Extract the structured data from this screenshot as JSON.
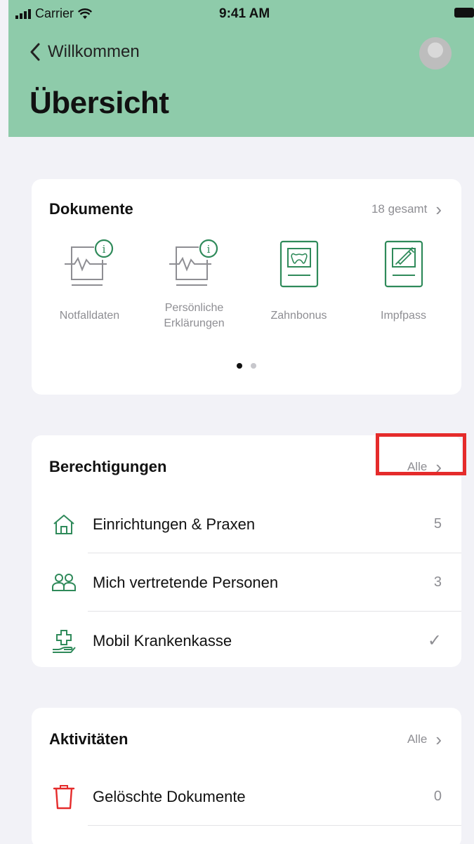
{
  "status_bar": {
    "carrier": "Carrier",
    "time": "9:41 AM"
  },
  "nav": {
    "back_label": "Willkommen",
    "title": "Übersicht"
  },
  "documents": {
    "title": "Dokumente",
    "total_label": "18 gesamt",
    "items": [
      {
        "label": "Notfalldaten",
        "icon": "health-info-icon"
      },
      {
        "label": "Persönliche Erklärungen",
        "icon": "health-info-icon"
      },
      {
        "label": "Zahnbonus",
        "icon": "tooth-document-icon"
      },
      {
        "label": "Impfpass",
        "icon": "syringe-document-icon"
      }
    ],
    "page_index": 1,
    "page_count": 2
  },
  "permissions": {
    "title": "Berechtigungen",
    "all_label": "Alle",
    "rows": [
      {
        "label": "Einrichtungen & Praxen",
        "value": "5",
        "icon": "house-icon"
      },
      {
        "label": "Mich vertretende Personen",
        "value": "3",
        "icon": "people-icon"
      },
      {
        "label": "Mobil Krankenkasse",
        "value": "✓",
        "icon": "insurance-hand-icon"
      }
    ]
  },
  "activities": {
    "title": "Aktivitäten",
    "all_label": "Alle",
    "rows": [
      {
        "label": "Gelöschte Dokumente",
        "value": "0",
        "icon": "trash-icon"
      }
    ]
  },
  "colors": {
    "header_bg": "#8ecbaa",
    "icon_green": "#2f8a5a",
    "accent_red": "#e52b2b",
    "secondary_text": "#8e8e93"
  }
}
